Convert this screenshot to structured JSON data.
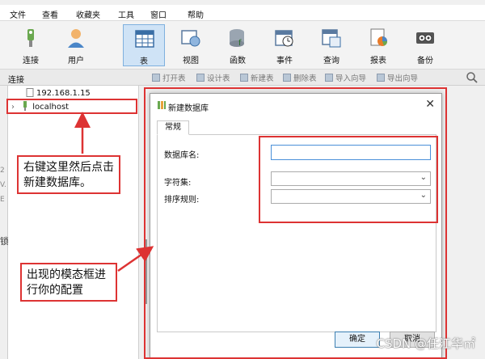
{
  "menu": [
    "文件",
    "查看",
    "收藏夹",
    "工具",
    "窗口",
    "帮助"
  ],
  "toolbar": {
    "buttons": [
      {
        "label": "连接",
        "icon": "connection-icon"
      },
      {
        "label": "用户",
        "icon": "user-icon"
      },
      {
        "label": "表",
        "icon": "table-icon"
      },
      {
        "label": "视图",
        "icon": "view-icon"
      },
      {
        "label": "函数",
        "icon": "function-icon"
      },
      {
        "label": "事件",
        "icon": "event-icon"
      },
      {
        "label": "查询",
        "icon": "query-icon"
      },
      {
        "label": "报表",
        "icon": "report-icon"
      },
      {
        "label": "备份",
        "icon": "backup-icon"
      }
    ],
    "active": "表"
  },
  "subbar": {
    "connection_label": "连接",
    "buttons": [
      "打开表",
      "设计表",
      "新建表",
      "删除表",
      "导入向导",
      "导出向导"
    ]
  },
  "sidebar": {
    "items": [
      "192.168.1.15",
      "localhost"
    ]
  },
  "left_strip": [
    "2",
    "V.",
    "E",
    "锁"
  ],
  "callouts": {
    "tree": "右键这里然后点击新建数据库。",
    "dialog": "出现的模态框进行你的配置"
  },
  "dialog": {
    "title": "新建数据库",
    "tab": "常规",
    "fields": {
      "db_name_label": "数据库名:",
      "db_name_value": "",
      "charset_label": "字符集:",
      "charset_value": "",
      "collation_label": "排序规则:",
      "collation_value": ""
    },
    "ok_label": "确定",
    "cancel_label": "取消"
  },
  "watermark": "CSDN @任江华㎡",
  "colors": {
    "annotation": "#dd3333",
    "active_tab": "#cfe3f6"
  }
}
